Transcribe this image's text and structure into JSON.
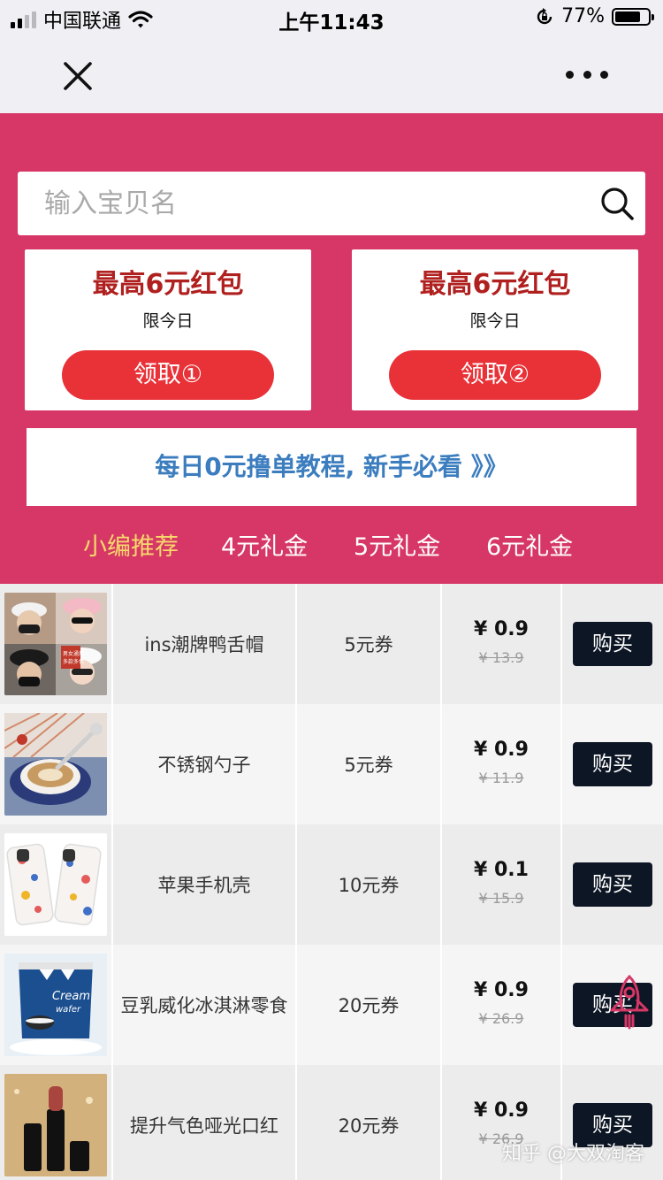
{
  "status_bar": {
    "carrier": "中国联通",
    "time": "上午11:43",
    "battery_text": "77%",
    "battery_level": 0.77
  },
  "nav": {
    "close_icon": "close-icon",
    "more_icon": "more-dots-icon"
  },
  "search": {
    "placeholder": "输入宝贝名",
    "icon": "search-icon"
  },
  "coupons": [
    {
      "title": "最高6元红包",
      "subtitle": "限今日",
      "button": "领取①"
    },
    {
      "title": "最高6元红包",
      "subtitle": "限今日",
      "button": "领取②"
    }
  ],
  "tutorial": {
    "label": "每日0元撸单教程, 新手必看 》》"
  },
  "tabs": [
    {
      "label": "小编推荐",
      "active": true
    },
    {
      "label": "4元礼金",
      "active": false
    },
    {
      "label": "5元礼金",
      "active": false
    },
    {
      "label": "6元礼金",
      "active": false
    }
  ],
  "products": [
    {
      "name": "ins潮牌鸭舌帽",
      "coupon": "5元券",
      "price": "¥ 0.9",
      "original_price": "¥ 13.9",
      "buy": "购买",
      "image": "caps-photo"
    },
    {
      "name": "不锈钢勺子",
      "coupon": "5元券",
      "price": "¥ 0.9",
      "original_price": "¥ 11.9",
      "buy": "购买",
      "image": "spoon-coffee-photo"
    },
    {
      "name": "苹果手机壳",
      "coupon": "10元券",
      "price": "¥ 0.1",
      "original_price": "¥ 15.9",
      "buy": "购买",
      "image": "phone-case-photo"
    },
    {
      "name": "豆乳威化冰淇淋零食",
      "coupon": "20元券",
      "price": "¥ 0.9",
      "original_price": "¥ 26.9",
      "buy": "购买",
      "image": "snack-bag-photo"
    },
    {
      "name": "提升气色哑光口红",
      "coupon": "20元券",
      "price": "¥ 0.9",
      "original_price": "¥ 26.9",
      "buy": "购买",
      "image": "lipstick-photo"
    }
  ],
  "floating": {
    "icon": "rocket-icon"
  },
  "watermark": {
    "text": "知乎 @大双淘客"
  },
  "colors": {
    "header_pink": "#d63766",
    "coupon_title_red": "#b0201f",
    "coupon_button_red": "#e83238",
    "tutorial_blue": "#3b7dbf",
    "active_tab_yellow": "#f7d96b",
    "buy_button_navy": "#0d1624"
  }
}
